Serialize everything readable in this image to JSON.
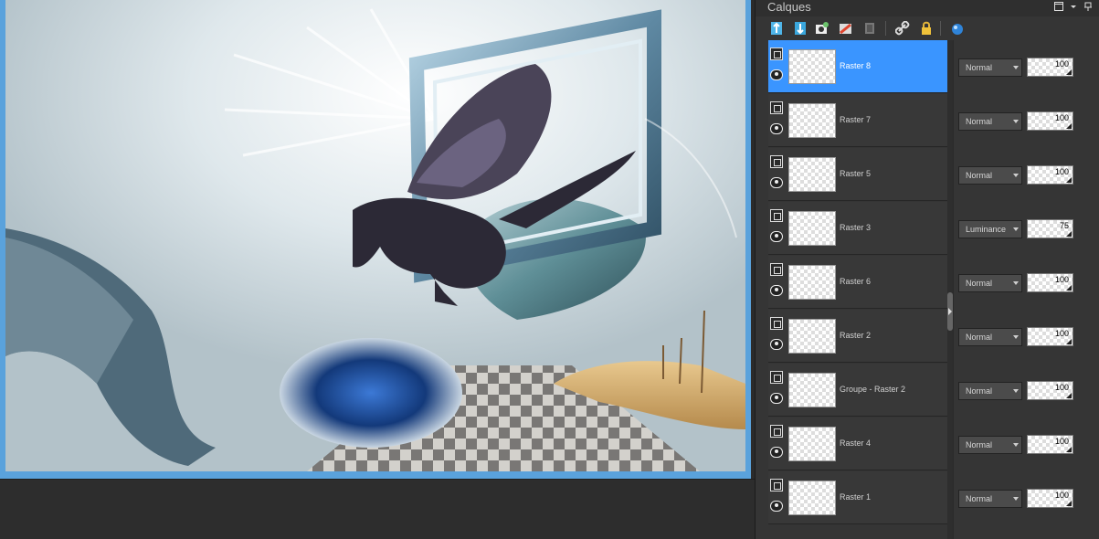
{
  "panel": {
    "title": "Calques",
    "header_buttons": [
      "maximize-icon",
      "dropdown-arrow-icon",
      "pin-icon"
    ],
    "toolbar_icons": [
      "new-raster-layer-icon",
      "new-vector-layer-icon",
      "new-mask-layer-icon",
      "adjustment-layer-icon",
      "delete-layer-icon",
      "link-icon",
      "lock-icon",
      "layer-style-icon"
    ]
  },
  "layers": [
    {
      "name": "Raster 8",
      "blend": "Normal",
      "opacity": "100",
      "selected": true
    },
    {
      "name": "Raster 7",
      "blend": "Normal",
      "opacity": "100",
      "selected": false
    },
    {
      "name": "Raster 5",
      "blend": "Normal",
      "opacity": "100",
      "selected": false
    },
    {
      "name": "Raster 3",
      "blend": "Luminance",
      "opacity": "75",
      "selected": false
    },
    {
      "name": "Raster 6",
      "blend": "Normal",
      "opacity": "100",
      "selected": false
    },
    {
      "name": "Raster 2",
      "blend": "Normal",
      "opacity": "100",
      "selected": false
    },
    {
      "name": "Groupe - Raster 2",
      "blend": "Normal",
      "opacity": "100",
      "selected": false
    },
    {
      "name": "Raster 4",
      "blend": "Normal",
      "opacity": "100",
      "selected": false
    },
    {
      "name": "Raster 1",
      "blend": "Normal",
      "opacity": "100",
      "selected": false
    }
  ],
  "colors": {
    "selection": "#3a95ff",
    "panel_bg": "#353535",
    "canvas_border": "#5aa2dc"
  }
}
